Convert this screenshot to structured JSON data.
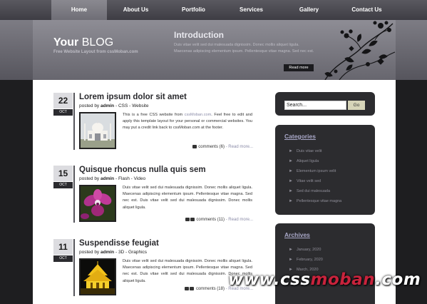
{
  "nav": {
    "items": [
      "Home",
      "About Us",
      "Portfolio",
      "Services",
      "Gallery",
      "Contact Us"
    ],
    "active": "Home"
  },
  "header": {
    "logo_bold": "Your",
    "logo_light": "BLOG",
    "tagline": "Free Website Layout from cssMoban.com",
    "intro_title": "Introduction",
    "intro_text": "Duis vitae velit sed dui malesuada dignissim. Donec mollis aliquet ligula. Maecenas adipiscing elementum ipsum. Pellentesque vitae magna. Sed nec est.",
    "read_more": "Read more"
  },
  "posts": [
    {
      "day": "22",
      "month": "OCT",
      "title": "Lorem ipsum dolor sit amet",
      "author_prefix": "posted by",
      "author": "admin",
      "categories": "- CSS - Website",
      "text_before": "This is a free CSS website from ",
      "text_link": "cssMoban.com",
      "text_after": ". Feel free to edit and apply this template layout for your personal or commercial websites. You may put a credit link back to cssMoban.com at the footer.",
      "comments": "comments (6)",
      "read_more": "- Read more..."
    },
    {
      "day": "15",
      "month": "OCT",
      "title": "Quisque rhoncus nulla quis sem",
      "author_prefix": "posted by",
      "author": "admin",
      "categories": "- Flash - Video",
      "text": "Duis vitae velit sed dui malesuada dignissim. Donec mollis aliquet ligula. Maecenas adipiscing elementum ipsum. Pellentesque vitae magna. Sed nec est. Duis vitae velit sed dui malesuada dignissim. Donec mollis aliquet ligula.",
      "comments": "comments (11)",
      "read_more": "- Read more..."
    },
    {
      "day": "11",
      "month": "OCT",
      "title": "Suspendisse feugiat",
      "author_prefix": "posted by",
      "author": "admin",
      "categories": "- 3D - Graphics",
      "text": "Duis vitae velit sed dui malesuada dignissim. Donec mollis aliquet ligula. Maecenas adipiscing elementum ipsum. Pellentesque vitae magna. Sed nec est. Duis vitae velit sed dui malesuada dignissim. Donec mollis aliquet ligula.",
      "comments": "comments (18)",
      "read_more": "- Read more..."
    }
  ],
  "sidebar": {
    "search_value": "Search...",
    "search_button": "Go",
    "categories_title": "Categories",
    "categories": [
      "Duis vitae velit",
      "Aliquet ligula",
      "Elementum ipsum velit",
      "Vitae velit sed",
      "Sed dui malesuada",
      "Pellentesque vitae magna"
    ],
    "archives_title": "Archives",
    "archives": [
      "January, 2020",
      "February, 2020",
      "March, 2020"
    ]
  },
  "watermark": {
    "pre": "www.css",
    "mid": "moban",
    "post": ".com"
  },
  "colors": {
    "link": "#8b8ca8",
    "sidebar_bg": "#2c2c2f",
    "sidebar_title": "#a9a8c8",
    "watermark_accent": "#c8233c"
  }
}
